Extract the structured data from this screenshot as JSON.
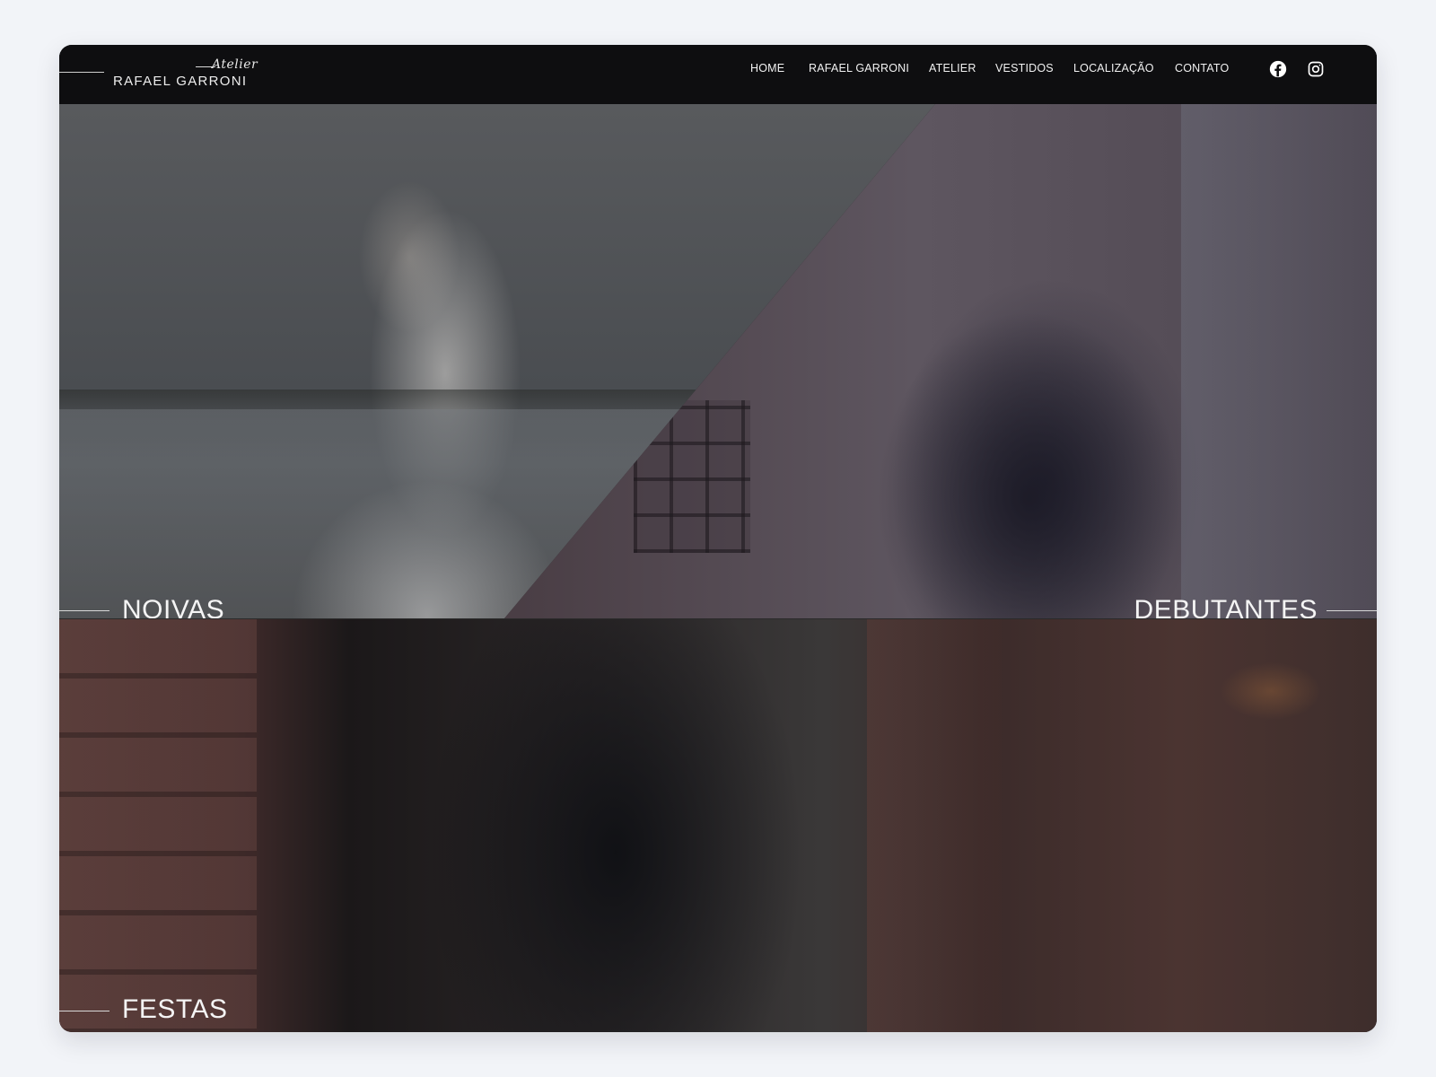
{
  "brand": {
    "script": "Atelier",
    "name": "RAFAEL GARRONI"
  },
  "nav": {
    "items": [
      "HOME",
      "RAFAEL GARRONI",
      "ATELIER",
      "VESTIDOS",
      "LOCALIZAÇÃO",
      "CONTATO"
    ]
  },
  "social": {
    "facebook_icon": "facebook-icon",
    "instagram_icon": "instagram-icon"
  },
  "sections": {
    "noivas": "NOIVAS",
    "debutantes": "DEBUTANTES",
    "festas": "FESTAS"
  },
  "colors": {
    "header_bg": "#0e0e10",
    "page_bg": "#f2f4f8",
    "text": "#f4f4f4"
  }
}
